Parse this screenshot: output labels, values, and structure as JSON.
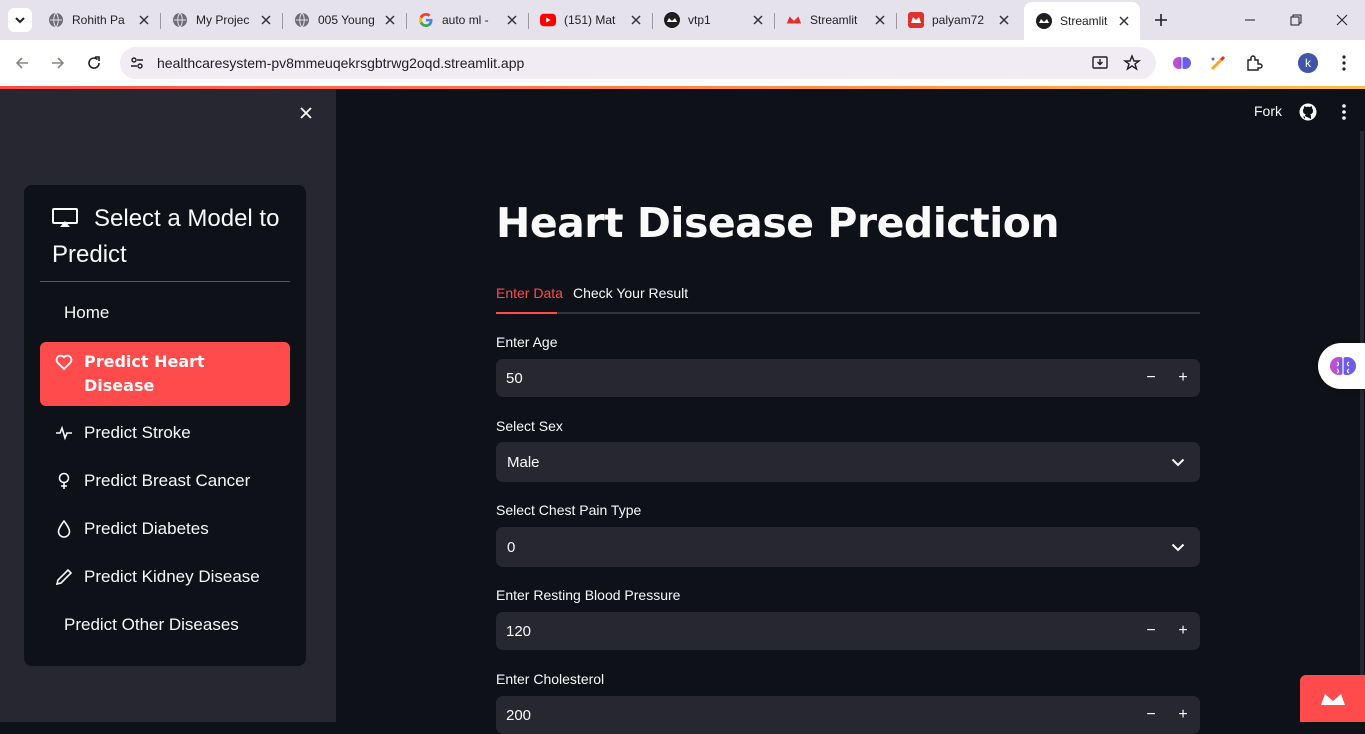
{
  "browser": {
    "tabs": [
      {
        "title": "Rohith Pa",
        "icon": "globe-icon"
      },
      {
        "title": "My Projec",
        "icon": "globe-icon"
      },
      {
        "title": "005 Young",
        "icon": "globe-icon"
      },
      {
        "title": "auto ml -",
        "icon": "google-icon"
      },
      {
        "title": "(151) Mat",
        "icon": "youtube-icon"
      },
      {
        "title": "vtp1",
        "icon": "streamlit-dark-icon"
      },
      {
        "title": "Streamlit",
        "icon": "streamlit-red-icon"
      },
      {
        "title": "palyam72",
        "icon": "streamlit-red-square-icon"
      },
      {
        "title": "Streamlit",
        "icon": "streamlit-dark-icon",
        "active": true
      }
    ],
    "url": "healthcaresystem-pv8mmeuqekrsgbtrwg2oqd.streamlit.app",
    "profile_initial": "k"
  },
  "sidebar": {
    "menu_title": "Select a Model to Predict",
    "items": [
      {
        "label": "Home",
        "icon": ""
      },
      {
        "label": "Predict Heart Disease",
        "icon": "heart-icon",
        "active": true
      },
      {
        "label": "Predict Stroke",
        "icon": "activity-icon"
      },
      {
        "label": "Predict Breast Cancer",
        "icon": "gender-female-icon"
      },
      {
        "label": "Predict Diabetes",
        "icon": "droplet-icon"
      },
      {
        "label": "Predict Kidney Disease",
        "icon": "pencil-icon"
      },
      {
        "label": "Predict Other Diseases",
        "icon": ""
      }
    ]
  },
  "header": {
    "fork_label": "Fork"
  },
  "main": {
    "title": "Heart Disease Prediction",
    "tabs": [
      {
        "label": "Enter Data",
        "active": true
      },
      {
        "label": "Check Your Result"
      }
    ],
    "fields": {
      "age": {
        "label": "Enter Age",
        "value": "50"
      },
      "sex": {
        "label": "Select Sex",
        "value": "Male"
      },
      "chest_pain": {
        "label": "Select Chest Pain Type",
        "value": "0"
      },
      "bp": {
        "label": "Enter Resting Blood Pressure",
        "value": "120"
      },
      "chol": {
        "label": "Enter Cholesterol",
        "value": "200"
      }
    },
    "stepper": {
      "minus": "−",
      "plus": "+"
    }
  },
  "colors": {
    "accent": "#ff4b4b",
    "background": "#0e1117",
    "sidebar": "#262730",
    "input": "#262730"
  }
}
